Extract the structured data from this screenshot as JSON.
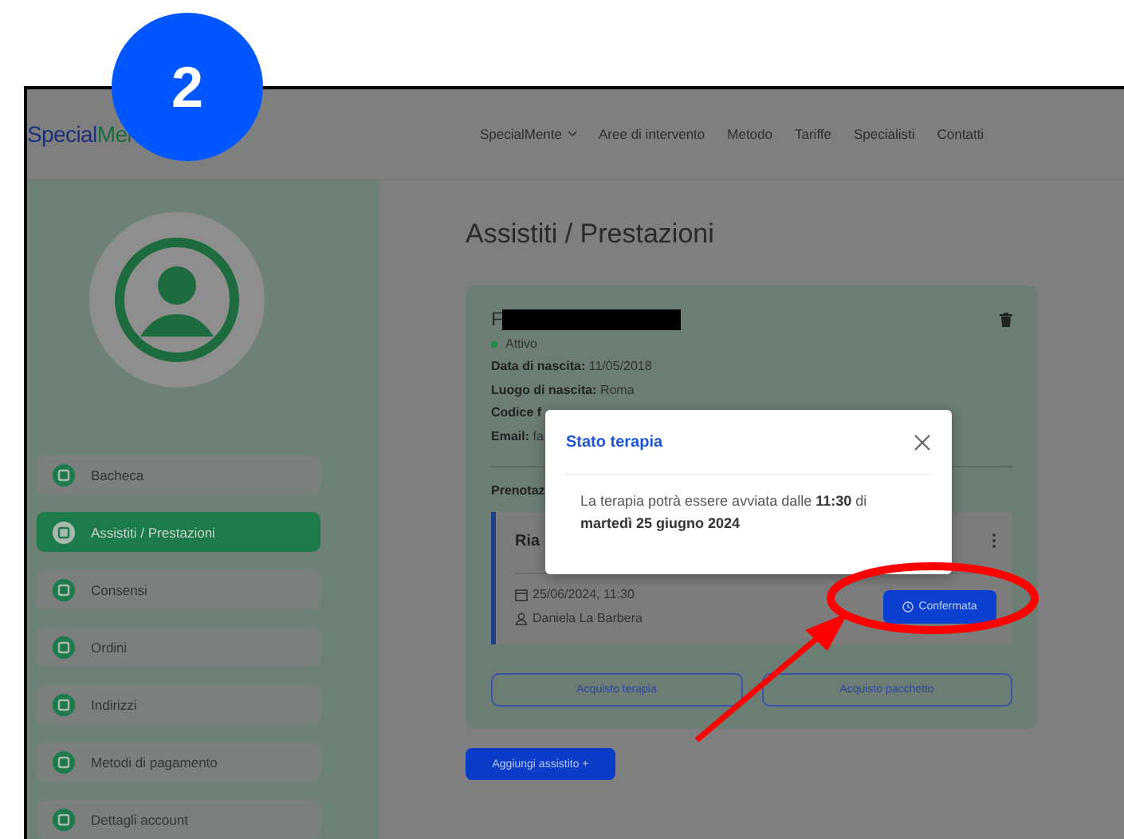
{
  "annotation": {
    "step_badge": "2"
  },
  "header": {
    "logo": {
      "part_1": "Special",
      "part_2": "Men"
    },
    "nav": [
      {
        "label": "SpecialMente",
        "dropdown": true
      },
      {
        "label": "Aree di intervento",
        "dropdown": false
      },
      {
        "label": "Metodo",
        "dropdown": false
      },
      {
        "label": "Tariffe",
        "dropdown": false
      },
      {
        "label": "Specialisti",
        "dropdown": false
      },
      {
        "label": "Contatti",
        "dropdown": false
      }
    ]
  },
  "sidebar": {
    "items": [
      {
        "label": "Bacheca",
        "selected": false
      },
      {
        "label": "Assistiti / Prestazioni",
        "selected": true
      },
      {
        "label": "Consensi",
        "selected": false
      },
      {
        "label": "Ordini",
        "selected": false
      },
      {
        "label": "Indirizzi",
        "selected": false
      },
      {
        "label": "Metodi di pagamento",
        "selected": false
      },
      {
        "label": "Dettagli account",
        "selected": false
      }
    ]
  },
  "main": {
    "title": "Assistiti / Prestazioni",
    "patient": {
      "name_initial": "F",
      "status": "Attivo",
      "fields": [
        {
          "label": "Data di nascita:",
          "value": "11/05/2018"
        },
        {
          "label": "Luogo di nascita:",
          "value": "Roma"
        },
        {
          "label": "Codice f"
        },
        {
          "label": "Email:",
          "value": "fa"
        }
      ],
      "section_label": "Prenotaz",
      "booking": {
        "title": "Ria",
        "date": "25/06/2024, 11:30",
        "specialist": "Daniela La Barbera",
        "status_button": "Confermata"
      },
      "actions": [
        "Acquisto terapia",
        "Acquisto pacchetto"
      ]
    },
    "add_button": "Aggiungi assistito +"
  },
  "modal": {
    "title": "Stato terapia",
    "message": "La terapia potrà essere avviata dalle **11:30** di **martedì 25 giugno 2024**"
  }
}
